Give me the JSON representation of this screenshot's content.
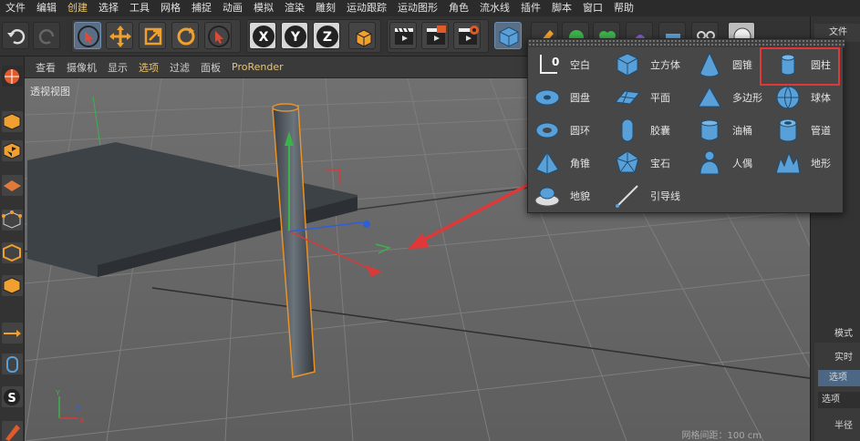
{
  "menu": [
    "文件",
    "编辑",
    "创建",
    "选择",
    "工具",
    "网格",
    "捕捉",
    "动画",
    "模拟",
    "渲染",
    "雕刻",
    "运动跟踪",
    "运动图形",
    "角色",
    "流水线",
    "插件",
    "脚本",
    "窗口",
    "帮助"
  ],
  "viewport_menu": [
    "查看",
    "摄像机",
    "显示",
    "选项",
    "过滤",
    "面板",
    "ProRender"
  ],
  "viewport_label": "透视视图",
  "grid_spacing": "网格间距：100 cm",
  "toolbar_axes": [
    "X",
    "Y",
    "Z"
  ],
  "right_panel": {
    "file_tab": "文件",
    "mode_tab": "模式",
    "realtime": "实时",
    "select_button": "选项",
    "select_label": "选项",
    "radius_label": "半径"
  },
  "popup_items": [
    {
      "label": "空白",
      "icon": "null-object-icon"
    },
    {
      "label": "立方体",
      "icon": "cube-icon"
    },
    {
      "label": "圆锥",
      "icon": "cone-icon"
    },
    {
      "label": "圆柱",
      "icon": "cylinder-icon"
    },
    {
      "label": "圆盘",
      "icon": "disc-icon"
    },
    {
      "label": "平面",
      "icon": "plane-icon"
    },
    {
      "label": "多边形",
      "icon": "polygon-icon"
    },
    {
      "label": "球体",
      "icon": "sphere-icon"
    },
    {
      "label": "圆环",
      "icon": "torus-icon"
    },
    {
      "label": "胶囊",
      "icon": "capsule-icon"
    },
    {
      "label": "油桶",
      "icon": "oil-tank-icon"
    },
    {
      "label": "管道",
      "icon": "tube-icon"
    },
    {
      "label": "角锥",
      "icon": "pyramid-icon"
    },
    {
      "label": "宝石",
      "icon": "platonic-icon"
    },
    {
      "label": "人偶",
      "icon": "figure-icon"
    },
    {
      "label": "地形",
      "icon": "landscape-icon"
    },
    {
      "label": "地貌",
      "icon": "relief-icon"
    },
    {
      "label": "引导线",
      "icon": "guide-icon"
    }
  ],
  "colors": {
    "highlight": "#e03838",
    "selected_object": "#e8922a",
    "accent_blue": "#5aa0d8"
  }
}
